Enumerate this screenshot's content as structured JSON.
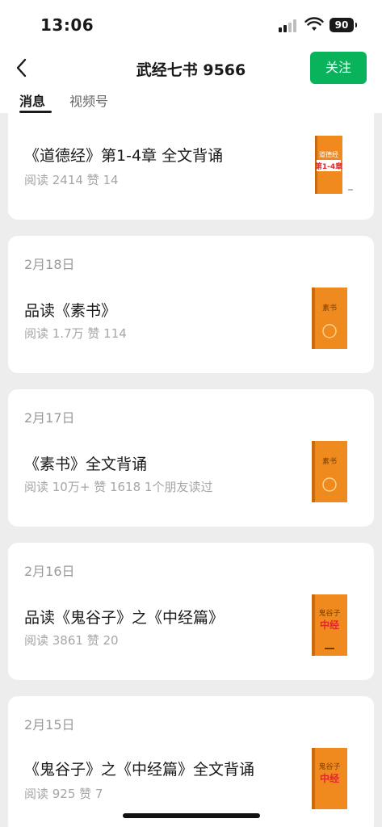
{
  "status": {
    "time": "13:06",
    "battery": "90"
  },
  "nav": {
    "title": "武经七书 9566",
    "follow_label": "关注"
  },
  "tabs": [
    {
      "label": "消息"
    },
    {
      "label": "视频号"
    }
  ],
  "posts": [
    {
      "date": "",
      "title": "《道德经》第1-4章 全文背诵",
      "meta": "阅读 2414  赞 14",
      "cover": {
        "title": "道德经",
        "subtitle": "第1-4章",
        "color": "#f08a1e",
        "text_color": "#ffffff",
        "accent": "#e02a2a"
      }
    },
    {
      "date": "2月18日",
      "title": "品读《素书》",
      "meta": "阅读 1.7万  赞 114",
      "cover": {
        "title": "素书",
        "subtitle": "",
        "color": "#ee8a1e",
        "text_color": "#7a3d00",
        "accent": "#7a3d00"
      }
    },
    {
      "date": "2月17日",
      "title": "《素书》全文背诵",
      "meta": "阅读 10万+  赞 1618  1个朋友读过",
      "cover": {
        "title": "素书",
        "subtitle": "",
        "color": "#ee8a1e",
        "text_color": "#7a3d00",
        "accent": "#7a3d00"
      }
    },
    {
      "date": "2月16日",
      "title": "品读《鬼谷子》之《中经篇》",
      "meta": "阅读 3861  赞 20",
      "cover": {
        "title": "鬼谷子",
        "subtitle": "中经",
        "color": "#f08a1e",
        "text_color": "#7a3d00",
        "accent": "#e02a2a"
      }
    },
    {
      "date": "2月15日",
      "title": "《鬼谷子》之《中经篇》全文背诵",
      "meta": "阅读 925  赞 7",
      "cover": {
        "title": "鬼谷子",
        "subtitle": "中经",
        "color": "#f08a1e",
        "text_color": "#7a3d00",
        "accent": "#e02a2a"
      }
    }
  ]
}
